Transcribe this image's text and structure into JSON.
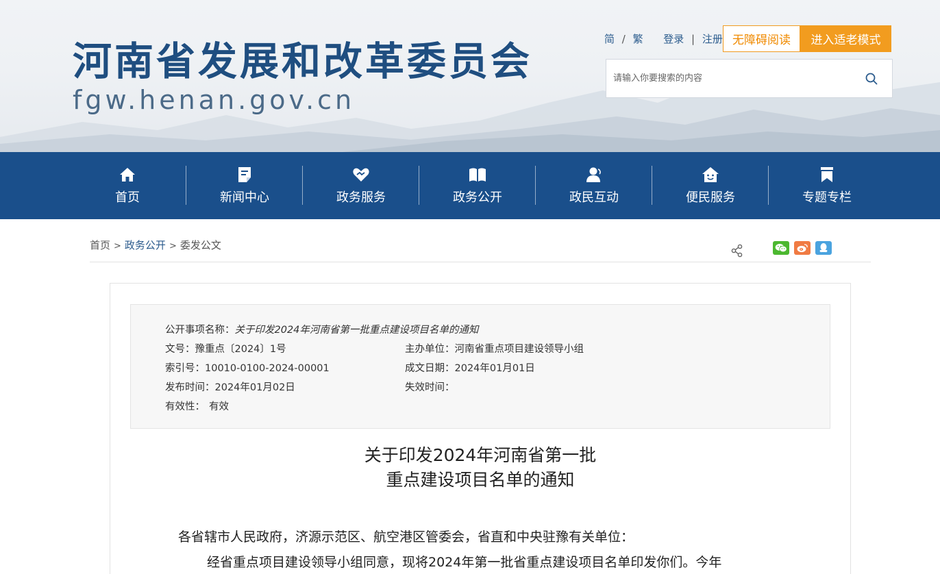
{
  "header": {
    "title": "河南省发展和改革委员会",
    "domain": "fgw.henan.gov.cn",
    "lang_simplified": "简",
    "lang_sep": "/",
    "lang_traditional": "繁",
    "login": "登录",
    "auth_sep": "|",
    "register": "注册",
    "accessible_reading": "无障碍阅读",
    "elder_mode": "进入适老模式",
    "search_placeholder": "请输入你要搜索的内容"
  },
  "nav": {
    "items": [
      {
        "label": "首页",
        "icon": "home-icon"
      },
      {
        "label": "新闻中心",
        "icon": "document-icon"
      },
      {
        "label": "政务服务",
        "icon": "heart-hands-icon"
      },
      {
        "label": "政务公开",
        "icon": "open-book-icon"
      },
      {
        "label": "政民互动",
        "icon": "user-icon"
      },
      {
        "label": "便民服务",
        "icon": "house-smile-icon"
      },
      {
        "label": "专题专栏",
        "icon": "bookmark-icon"
      }
    ]
  },
  "breadcrumb": {
    "items": [
      "首页",
      "政务公开",
      "委发公文"
    ],
    "separator": ">"
  },
  "share": {
    "share_icon": "share-icon",
    "wechat_icon": "wechat-icon",
    "weibo_icon": "weibo-icon",
    "qq_icon": "qq-icon"
  },
  "info": {
    "item_name_label": "公开事项名称：",
    "item_name_value": "关于印发2024年河南省第一批重点建设项目名单的通知",
    "doc_no_label": "文号：",
    "doc_no_value": "豫重点〔2024〕1号",
    "host_label": "主办单位：",
    "host_value": "河南省重点项目建设领导小组",
    "index_label": "索引号：",
    "index_value": "10010-0100-2024-00001",
    "written_date_label": "成文日期：",
    "written_date_value": "2024年01月01日",
    "publish_label": "发布时间：",
    "publish_value": "2024年01月02日",
    "expire_label": "失效时间：",
    "expire_value": "",
    "validity_label": "有效性：",
    "validity_value": "有效"
  },
  "document": {
    "title_line1": "关于印发2024年河南省第一批",
    "title_line2": "重点建设项目名单的通知",
    "salutation": "各省辖市人民政府，济源示范区、航空港区管委会，省直和中央驻豫有关单位：",
    "para1_start": "经省重点项目建设领导小组同意，现将2024年第一批省重点建设项目名单印发你们。今年"
  },
  "colors": {
    "nav_bg": "#1a4f8b",
    "title_blue": "#1f4e80",
    "accent_orange": "#f29c1f"
  }
}
